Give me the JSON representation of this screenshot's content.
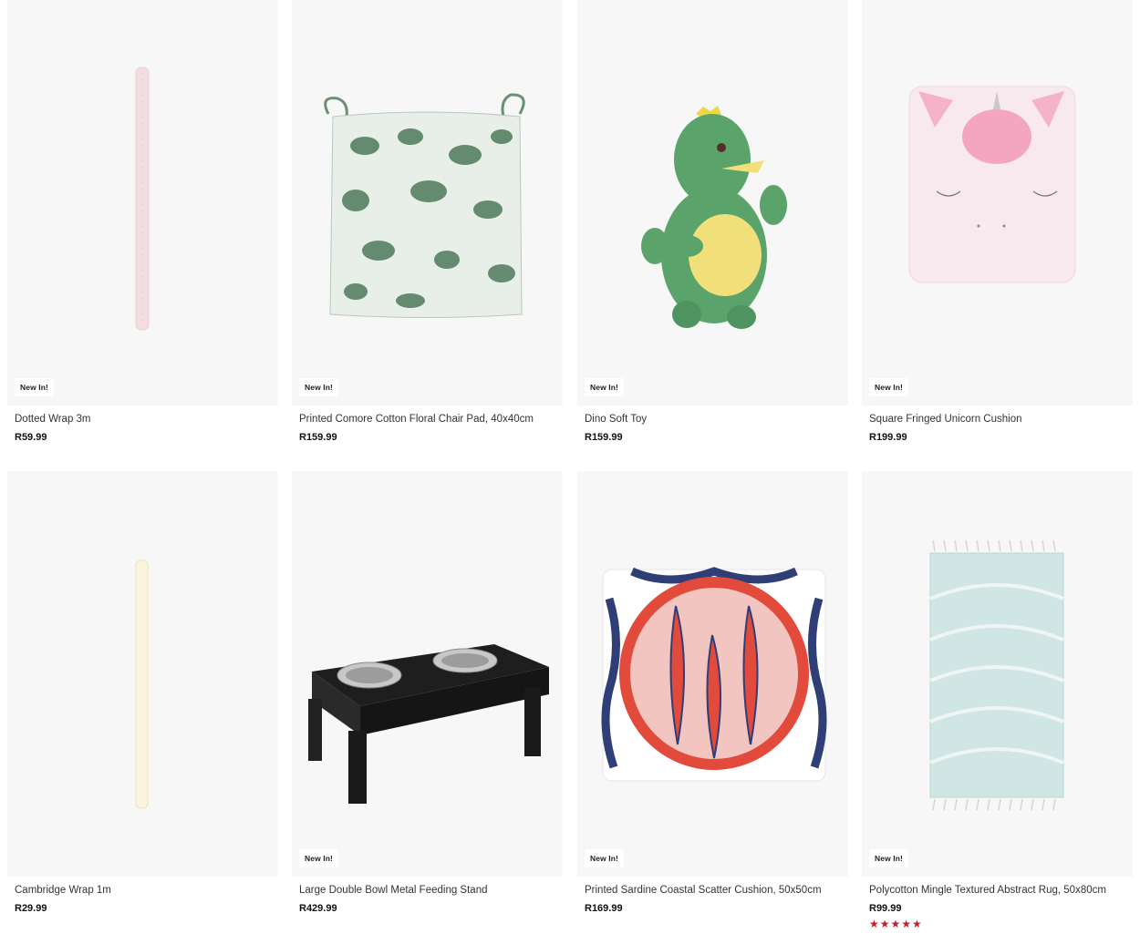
{
  "products": [
    {
      "name": "Dotted Wrap 3m",
      "price": "R59.99",
      "badge": "New In!"
    },
    {
      "name": "Printed Comore Cotton Floral Chair Pad, 40x40cm",
      "price": "R159.99",
      "badge": "New In!"
    },
    {
      "name": "Dino Soft Toy",
      "price": "R159.99",
      "badge": "New In!"
    },
    {
      "name": "Square Fringed Unicorn Cushion",
      "price": "R199.99",
      "badge": "New In!"
    },
    {
      "name": "Cambridge Wrap 1m",
      "price": "R29.99",
      "badge": ""
    },
    {
      "name": "Large Double Bowl Metal Feeding Stand",
      "price": "R429.99",
      "badge": "New In!"
    },
    {
      "name": "Printed Sardine Coastal Scatter Cushion, 50x50cm",
      "price": "R169.99",
      "badge": "New In!"
    },
    {
      "name": "Polycotton Mingle Textured Abstract Rug, 50x80cm",
      "price": "R99.99",
      "badge": "New In!",
      "rating": "★★★★★",
      "rating_value": 5
    }
  ],
  "colors": {
    "accent_star": "#d0192b",
    "image_bg": "#f7f7f7"
  }
}
